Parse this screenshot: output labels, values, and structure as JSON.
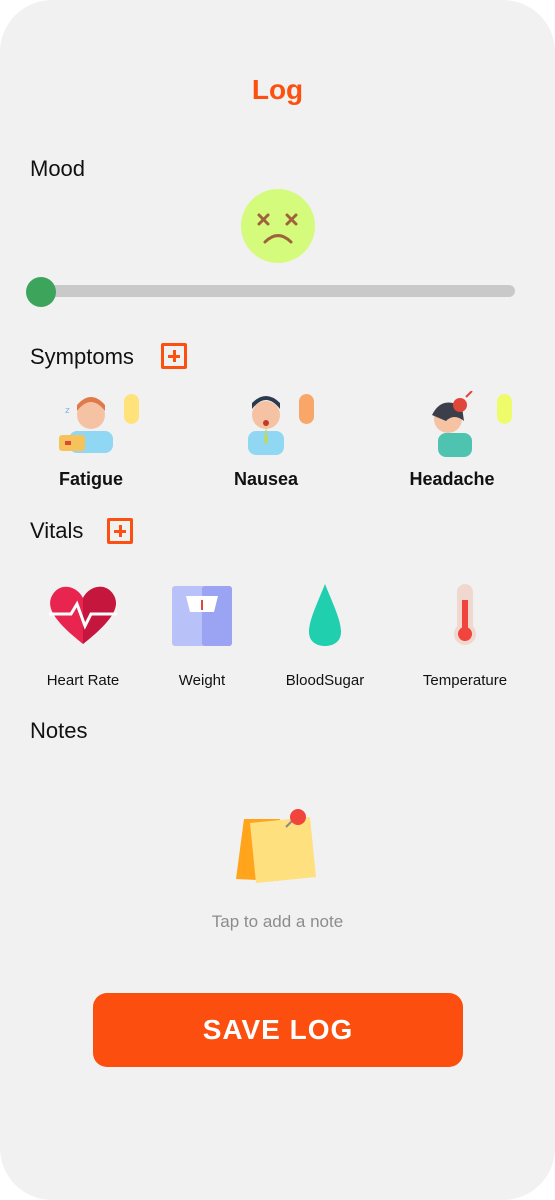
{
  "header": {
    "title": "Log"
  },
  "mood": {
    "label": "Mood",
    "face": "dizzy-sad-face-icon",
    "face_color": "#d4fb7c",
    "slider_value": 0,
    "slider_color": "#3da55b"
  },
  "symptoms": {
    "label": "Symptoms",
    "add_icon": "add-icon",
    "items": [
      {
        "label": "Fatigue",
        "icon": "fatigue-person-icon",
        "severity_color": "#ffe27a"
      },
      {
        "label": "Nausea",
        "icon": "nausea-person-icon",
        "severity_color": "#f8a768"
      },
      {
        "label": "Headache",
        "icon": "headache-person-icon",
        "severity_color": "#eefc6c"
      }
    ]
  },
  "vitals": {
    "label": "Vitals",
    "add_icon": "add-icon",
    "items": [
      {
        "label": "Heart Rate",
        "icon": "heart-rate-icon"
      },
      {
        "label": "Weight",
        "icon": "weight-scale-icon"
      },
      {
        "label": "BloodSugar",
        "icon": "blood-drop-icon"
      },
      {
        "label": "Temperature",
        "icon": "thermometer-icon"
      }
    ]
  },
  "notes": {
    "label": "Notes",
    "hint": "Tap to add a note",
    "icon": "sticky-note-icon"
  },
  "actions": {
    "save_label": "SAVE LOG"
  },
  "colors": {
    "accent": "#fc5010",
    "background": "#f1f1f1"
  }
}
